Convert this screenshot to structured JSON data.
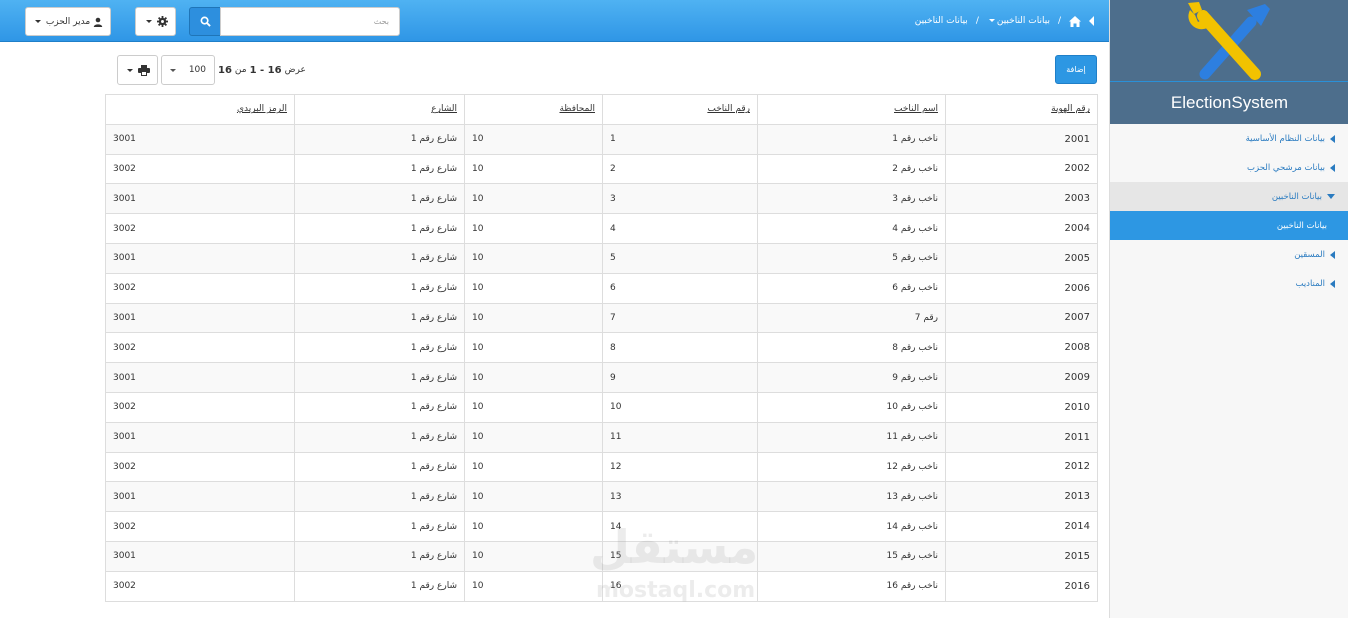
{
  "topbar": {
    "user_label": "مدير الحزب",
    "search_placeholder": "بحث",
    "breadcrumb": {
      "section": "بيانات الناخبين",
      "current": "بيانات الناخبين"
    }
  },
  "sidebar": {
    "brand": "ElectionSystem",
    "items": [
      {
        "label": "بيانات النظام الأساسية"
      },
      {
        "label": "بيانات مرشحي الحزب"
      },
      {
        "label": "بيانات الناخبين"
      },
      {
        "label": "بيانات الناخبين"
      },
      {
        "label": "المسقين"
      },
      {
        "label": "المناديب"
      }
    ]
  },
  "toolbar": {
    "add_label": "إضافة",
    "page_size": "100",
    "pager_prefix": "عرض",
    "pager_range": "1 - 16",
    "pager_of": "من",
    "pager_total": "16"
  },
  "table": {
    "headers": [
      "رقم الهوية",
      "اسم الناخب",
      "رقم الناخب",
      "المحافظة",
      "الشارع",
      "الرمز البريدي"
    ],
    "rows": [
      [
        "2001",
        "ناخب رقم 1",
        "1",
        "10",
        "شارع رقم 1",
        "3001"
      ],
      [
        "2002",
        "ناخب رقم 2",
        "2",
        "10",
        "شارع رقم 1",
        "3002"
      ],
      [
        "2003",
        "ناخب رقم 3",
        "3",
        "10",
        "شارع رقم 1",
        "3001"
      ],
      [
        "2004",
        "ناخب رقم 4",
        "4",
        "10",
        "شارع رقم 1",
        "3002"
      ],
      [
        "2005",
        "ناخب رقم 5",
        "5",
        "10",
        "شارع رقم 1",
        "3001"
      ],
      [
        "2006",
        "ناخب رقم 6",
        "6",
        "10",
        "شارع رقم 1",
        "3002"
      ],
      [
        "2007",
        "رقم 7",
        "7",
        "10",
        "شارع رقم 1",
        "3001"
      ],
      [
        "2008",
        "ناخب رقم 8",
        "8",
        "10",
        "شارع رقم 1",
        "3002"
      ],
      [
        "2009",
        "ناخب رقم 9",
        "9",
        "10",
        "شارع رقم 1",
        "3001"
      ],
      [
        "2010",
        "ناخب رقم 10",
        "10",
        "10",
        "شارع رقم 1",
        "3002"
      ],
      [
        "2011",
        "ناخب رقم 11",
        "11",
        "10",
        "شارع رقم 1",
        "3001"
      ],
      [
        "2012",
        "ناخب رقم 12",
        "12",
        "10",
        "شارع رقم 1",
        "3002"
      ],
      [
        "2013",
        "ناخب رقم 13",
        "13",
        "10",
        "شارع رقم 1",
        "3001"
      ],
      [
        "2014",
        "ناخب رقم 14",
        "14",
        "10",
        "شارع رقم 1",
        "3002"
      ],
      [
        "2015",
        "ناخب رقم 15",
        "15",
        "10",
        "شارع رقم 1",
        "3001"
      ],
      [
        "2016",
        "ناخب رقم 16",
        "16",
        "10",
        "شارع رقم 1",
        "3002"
      ]
    ]
  },
  "watermark": {
    "arabic": "مستقل",
    "latin": "mostaql.com"
  },
  "colors": {
    "accent": "#2d97e3",
    "logo_bg": "#4d6e8c",
    "logo_wrench": "#f2c200",
    "logo_screwdriver": "#2d7fe0"
  },
  "icons": {
    "user": "user-icon",
    "gear": "gear-icon",
    "search": "search-icon",
    "home": "home-icon",
    "print": "print-icon",
    "logo": "tools-logo-icon"
  }
}
